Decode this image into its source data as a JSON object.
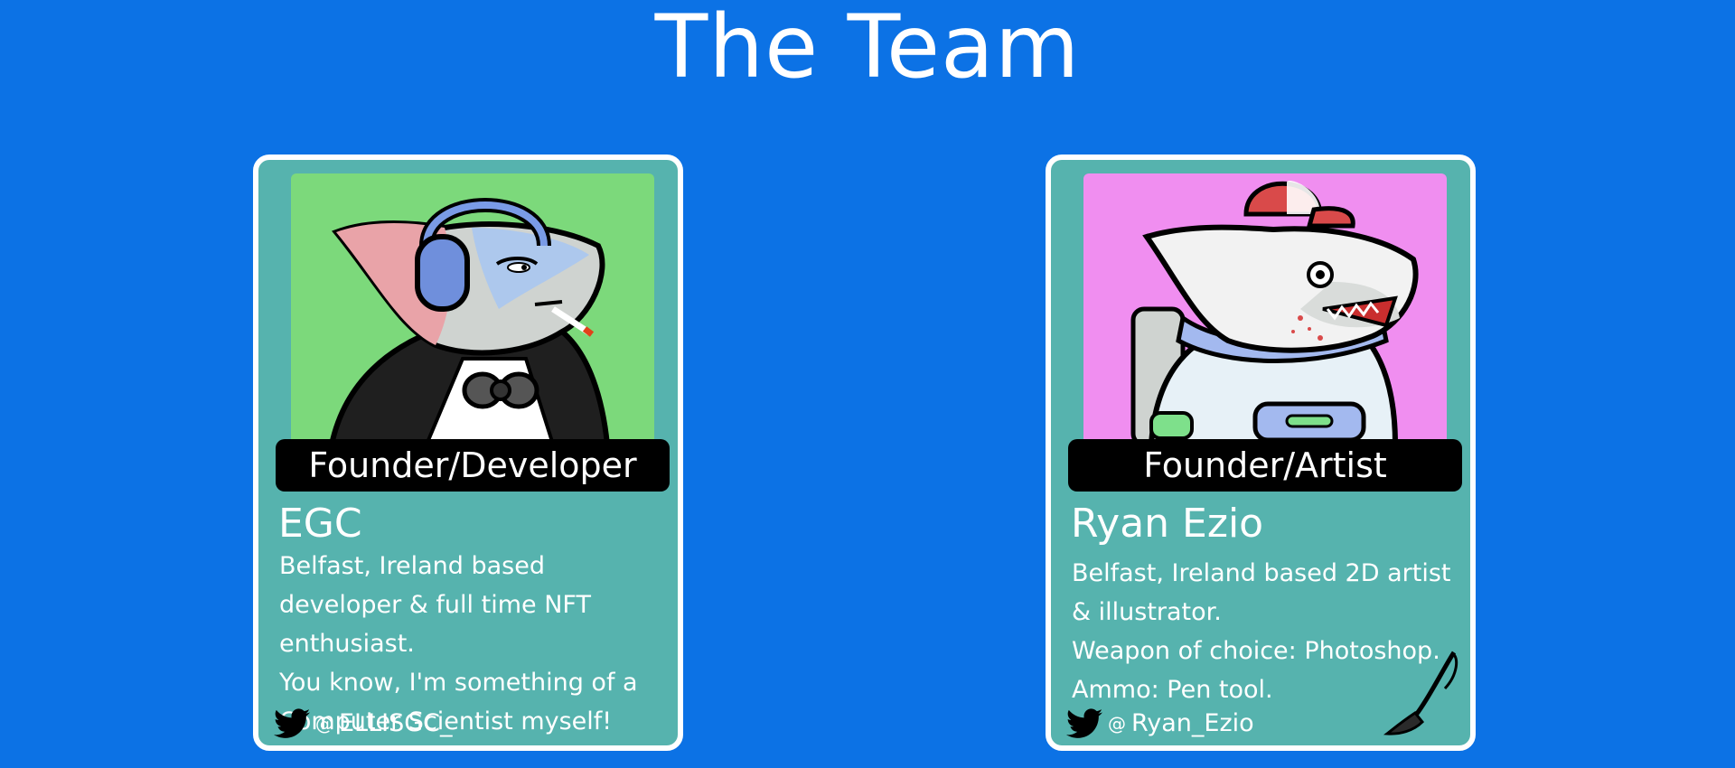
{
  "page": {
    "title": "The Team"
  },
  "colors": {
    "background": "#0c72e5",
    "card": "#56b3ae",
    "card_border": "#ffffff"
  },
  "team": [
    {
      "role": "Founder/Developer",
      "name": "EGC",
      "bio": [
        "Belfast, Ireland based developer & full time NFT enthusiast.",
        "You know, I'm something of a Computer Scientist myself!"
      ],
      "twitter_at": "@",
      "twitter_handle": "ELLISGC_",
      "portrait_bg": "#7cd97b",
      "icon": "twitter-bird-icon"
    },
    {
      "role": "Founder/Artist",
      "name": "Ryan Ezio",
      "bio": [
        "Belfast, Ireland based 2D artist & illustrator.",
        "Weapon of choice: Photoshop.",
        "Ammo: Pen tool."
      ],
      "twitter_at": "@",
      "twitter_handle": "Ryan_Ezio",
      "portrait_bg": "#f08ef0",
      "icon": "twitter-bird-icon",
      "decoration": "paintbrush-icon"
    }
  ]
}
